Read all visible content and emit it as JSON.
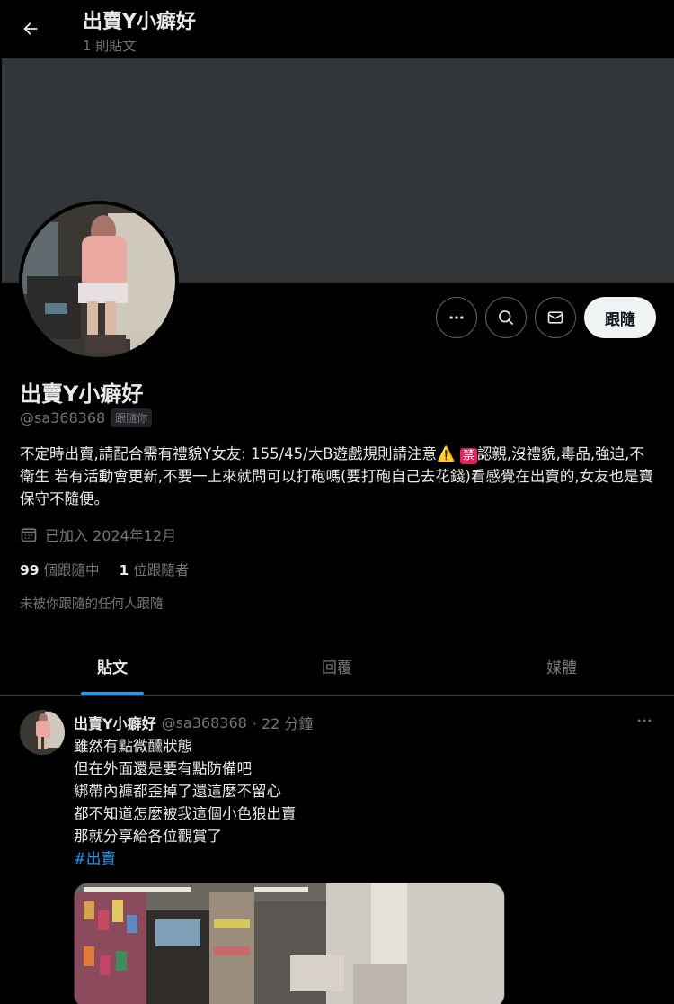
{
  "topbar": {
    "title": "出賣Y小癖好",
    "post_count": "1 則貼文"
  },
  "profile": {
    "display_name": "出賣Y小癖好",
    "handle": "@sa368368",
    "follows_you": "跟隨你",
    "bio_part1": "不定時出賣,請配合需有禮貌Y女友: 155/45/大B遊戲規則請注意",
    "bio_prohibited": "禁",
    "bio_part2": "認親,沒禮貌,毒品,強迫,不衛生 若有活動會更新,不要一上來就問可以打砲嗎(要打砲自己去花錢)看感覺在出賣的,女友也是寶 保守不隨便。",
    "joined": "已加入 2024年12月",
    "following_count": "99",
    "following_label": "個跟隨中",
    "followers_count": "1",
    "followers_label": "位跟隨者",
    "not_followed_text": "未被你跟隨的任何人跟隨"
  },
  "actions": {
    "follow_label": "跟隨"
  },
  "tabs": [
    {
      "label": "貼文",
      "active": true
    },
    {
      "label": "回覆",
      "active": false
    },
    {
      "label": "媒體",
      "active": false
    }
  ],
  "tweet": {
    "author_name": "出賣Y小癖好",
    "author_handle": "@sa368368",
    "time": "· 22 分鐘",
    "lines": [
      "雖然有點微醺狀態",
      "但在外面還是要有點防備吧",
      "綁帶內褲都歪掉了還這麼不留心",
      "都不知道怎麼被我這個小色狼出賣",
      "那就分享給各位觀賞了"
    ],
    "hashtag": "#出賣"
  },
  "colors": {
    "background": "#000000",
    "banner": "#333639",
    "accent": "#1d9bf0",
    "muted_text": "#71767b",
    "border": "#2f3336"
  },
  "icons": [
    "back-arrow-icon",
    "more-icon",
    "search-icon",
    "message-icon",
    "calendar-icon",
    "warning-icon"
  ]
}
